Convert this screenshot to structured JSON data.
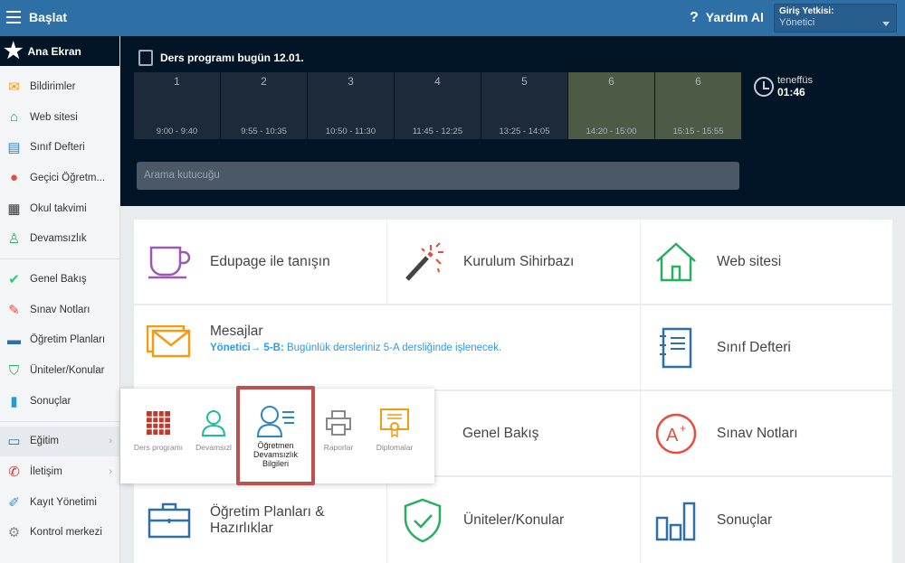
{
  "topbar": {
    "title": "Başlat",
    "help": "Yardım Al",
    "role_label": "Giriş Yetkisi:",
    "role_value": "Yönetici"
  },
  "sidebar": {
    "home": "Ana Ekran",
    "items": [
      {
        "label": "Bildirimler",
        "icon": "envelope-icon"
      },
      {
        "label": "Web sitesi",
        "icon": "house-icon"
      },
      {
        "label": "Sınıf Defteri",
        "icon": "notebook-icon"
      },
      {
        "label": "Geçici Öğretm...",
        "icon": "person-icon"
      },
      {
        "label": "Okul takvimi",
        "icon": "calendar-icon"
      },
      {
        "label": "Devamsızlık",
        "icon": "person-outline-icon"
      },
      {
        "label": "Genel Bakış",
        "icon": "check-circle-icon"
      },
      {
        "label": "Sınav Notları",
        "icon": "grade-icon"
      },
      {
        "label": "Öğretim Planları",
        "icon": "briefcase-icon"
      },
      {
        "label": "Üniteler/Konular",
        "icon": "shield-icon"
      },
      {
        "label": "Sonuçlar",
        "icon": "bar-chart-icon"
      },
      {
        "label": "Eğitim",
        "icon": "book-icon"
      },
      {
        "label": "İletişim",
        "icon": "chat-icon"
      },
      {
        "label": "Kayıt Yönetimi",
        "icon": "pen-icon"
      },
      {
        "label": "Kontrol merkezi",
        "icon": "gear-icon"
      }
    ]
  },
  "schedule": {
    "title": "Ders programı bugün 12.01.",
    "slots": [
      {
        "n": "1",
        "t": "9:00 - 9:40"
      },
      {
        "n": "2",
        "t": "9:55 - 10:35"
      },
      {
        "n": "3",
        "t": "10:50 - 11:30"
      },
      {
        "n": "4",
        "t": "11:45 - 12:25"
      },
      {
        "n": "5",
        "t": "13:25 - 14:05"
      },
      {
        "n": "6",
        "t": "14:20 - 15:00"
      },
      {
        "n": "6",
        "t": "15:15 - 15:55"
      }
    ],
    "break_label": "teneffüs",
    "break_time": "01:46"
  },
  "search": {
    "placeholder": "Arama kutucuğu"
  },
  "tiles": {
    "intro": "Edupage ile tanışın",
    "wizard": "Kurulum Sihirbazı",
    "website": "Web sitesi",
    "messages": "Mesajlar",
    "msg_from": "Yönetici→ 5-B:",
    "msg_text": " Bugünlük dersleriniz 5-A dersliğinde işlenecek.",
    "classbook": "Sınıf Defteri",
    "overview": "Genel Bakış",
    "grades": "Sınav Notları",
    "plans": "Öğretim Planları & Hazırlıklar",
    "topics": "Üniteler/Konular",
    "results": "Sonuçlar"
  },
  "popup": {
    "items": [
      "Ders programı",
      "Devamsızl",
      "Öğretmen Devamsızlık Bilgileri",
      "Raporlar",
      "Diplomalar"
    ]
  }
}
